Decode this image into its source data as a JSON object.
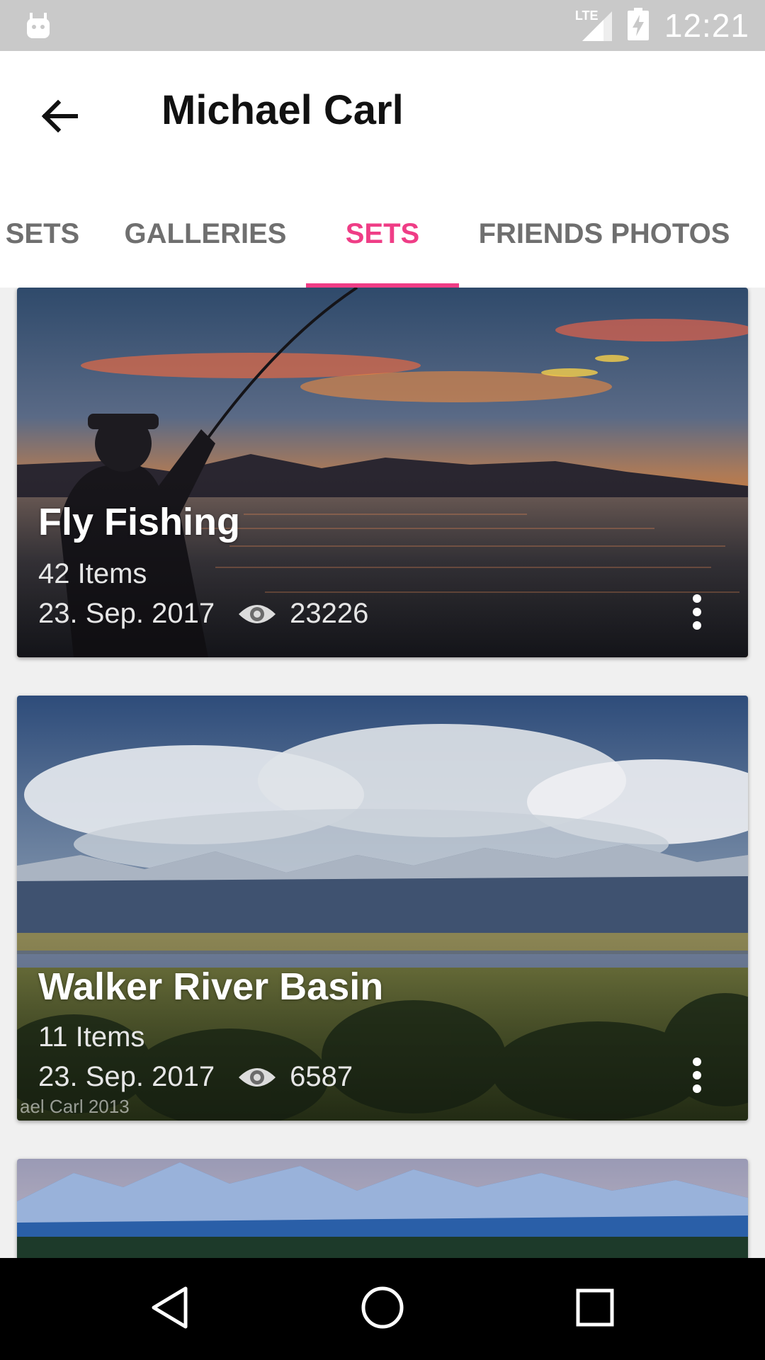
{
  "status_bar": {
    "network": "LTE",
    "time": "12:21",
    "icons": [
      "android-notification-icon",
      "lte-signal-icon",
      "battery-charging-icon"
    ]
  },
  "app_bar": {
    "title": "Michael Carl",
    "back_icon": "arrow-back-icon"
  },
  "tabs": [
    {
      "label": "SETS",
      "active": false
    },
    {
      "label": "GALLERIES",
      "active": false
    },
    {
      "label": "SETS",
      "active": true
    },
    {
      "label": "FRIENDS PHOTOS",
      "active": false
    }
  ],
  "accent_color": "#ef3d86",
  "cards": [
    {
      "title": "Fly Fishing",
      "items": "42 Items",
      "date": "23. Sep. 2017",
      "views": "23226",
      "icon_views": "eye-icon",
      "icon_more": "more-vert-icon"
    },
    {
      "title": "Walker River Basin",
      "items": "11 Items",
      "date": "23. Sep. 2017",
      "views": "6587",
      "watermark": "ael Carl 2013",
      "icon_views": "eye-icon",
      "icon_more": "more-vert-icon"
    }
  ],
  "nav_bar": {
    "icons": [
      "back-triangle-icon",
      "home-circle-icon",
      "recents-square-icon"
    ]
  }
}
